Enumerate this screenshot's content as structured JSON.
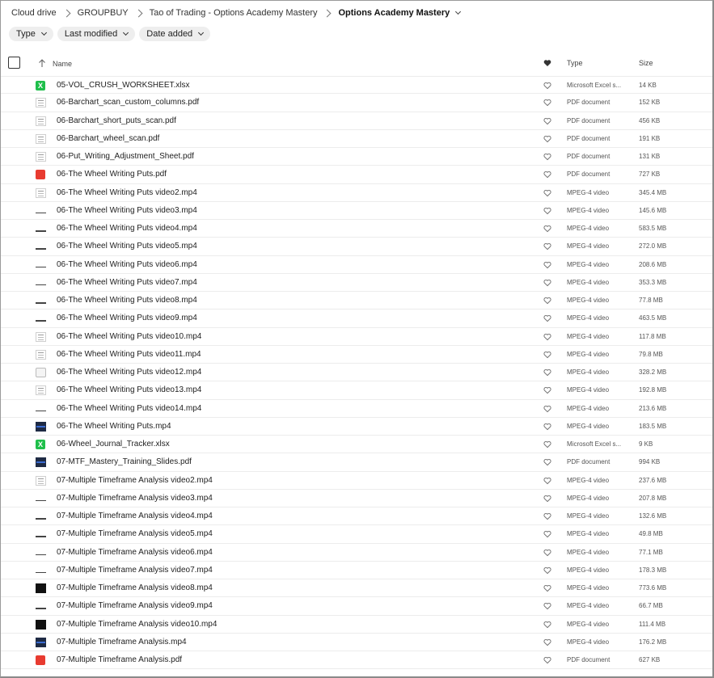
{
  "breadcrumb": {
    "items": [
      "Cloud drive",
      "GROUPBUY",
      "Tao of Trading - Options Academy Mastery"
    ],
    "current": "Options Academy Mastery"
  },
  "filters": {
    "type": "Type",
    "last_modified": "Last modified",
    "date_added": "Date added"
  },
  "columns": {
    "name": "Name",
    "type": "Type",
    "size": "Size"
  },
  "files": [
    {
      "name": "05-VOL_CRUSH_WORKSHEET.xlsx",
      "type": "Microsoft Excel s...",
      "size": "14 KB",
      "icon": "xlsx-icon"
    },
    {
      "name": "06-Barchart_scan_custom_columns.pdf",
      "type": "PDF document",
      "size": "152 KB",
      "icon": "document-thumbnail-icon"
    },
    {
      "name": "06-Barchart_short_puts_scan.pdf",
      "type": "PDF document",
      "size": "456 KB",
      "icon": "document-thumbnail-icon"
    },
    {
      "name": "06-Barchart_wheel_scan.pdf",
      "type": "PDF document",
      "size": "191 KB",
      "icon": "document-thumbnail-icon"
    },
    {
      "name": "06-Put_Writing_Adjustment_Sheet.pdf",
      "type": "PDF document",
      "size": "131 KB",
      "icon": "document-thumbnail-icon"
    },
    {
      "name": "06-The Wheel Writing Puts.pdf",
      "type": "PDF document",
      "size": "727 KB",
      "icon": "pdf-icon"
    },
    {
      "name": "06-The Wheel Writing Puts video2.mp4",
      "type": "MPEG-4 video",
      "size": "345.4 MB",
      "icon": "document-thumbnail-icon"
    },
    {
      "name": "06-The Wheel Writing Puts video3.mp4",
      "type": "MPEG-4 video",
      "size": "145.6 MB",
      "icon": "video-thumbnail-icon"
    },
    {
      "name": "06-The Wheel Writing Puts video4.mp4",
      "type": "MPEG-4 video",
      "size": "583.5 MB",
      "icon": "video-thumbnail-icon"
    },
    {
      "name": "06-The Wheel Writing Puts video5.mp4",
      "type": "MPEG-4 video",
      "size": "272.0 MB",
      "icon": "video-thumbnail-icon"
    },
    {
      "name": "06-The Wheel Writing Puts video6.mp4",
      "type": "MPEG-4 video",
      "size": "208.6 MB",
      "icon": "video-thumbnail-icon"
    },
    {
      "name": "06-The Wheel Writing Puts video7.mp4",
      "type": "MPEG-4 video",
      "size": "353.3 MB",
      "icon": "video-thumbnail-icon"
    },
    {
      "name": "06-The Wheel Writing Puts video8.mp4",
      "type": "MPEG-4 video",
      "size": "77.8 MB",
      "icon": "video-thumbnail-icon"
    },
    {
      "name": "06-The Wheel Writing Puts video9.mp4",
      "type": "MPEG-4 video",
      "size": "463.5 MB",
      "icon": "video-thumbnail-icon"
    },
    {
      "name": "06-The Wheel Writing Puts video10.mp4",
      "type": "MPEG-4 video",
      "size": "117.8 MB",
      "icon": "document-thumbnail-icon"
    },
    {
      "name": "06-The Wheel Writing Puts video11.mp4",
      "type": "MPEG-4 video",
      "size": "79.8 MB",
      "icon": "document-thumbnail-icon"
    },
    {
      "name": "06-The Wheel Writing Puts video12.mp4",
      "type": "MPEG-4 video",
      "size": "328.2 MB",
      "icon": "gear-thumbnail-icon"
    },
    {
      "name": "06-The Wheel Writing Puts video13.mp4",
      "type": "MPEG-4 video",
      "size": "192.8 MB",
      "icon": "document-thumbnail-icon"
    },
    {
      "name": "06-The Wheel Writing Puts video14.mp4",
      "type": "MPEG-4 video",
      "size": "213.6 MB",
      "icon": "video-thumbnail-icon"
    },
    {
      "name": "06-The Wheel Writing Puts.mp4",
      "type": "MPEG-4 video",
      "size": "183.5 MB",
      "icon": "dark-thumbnail-icon"
    },
    {
      "name": "06-Wheel_Journal_Tracker.xlsx",
      "type": "Microsoft Excel s...",
      "size": "9 KB",
      "icon": "xlsx-icon"
    },
    {
      "name": "07-MTF_Mastery_Training_Slides.pdf",
      "type": "PDF document",
      "size": "994 KB",
      "icon": "dark-thumbnail-icon"
    },
    {
      "name": "07-Multiple Timeframe Analysis video2.mp4",
      "type": "MPEG-4 video",
      "size": "237.6 MB",
      "icon": "document-thumbnail-icon"
    },
    {
      "name": "07-Multiple Timeframe Analysis video3.mp4",
      "type": "MPEG-4 video",
      "size": "207.8 MB",
      "icon": "video-thumbnail-icon"
    },
    {
      "name": "07-Multiple Timeframe Analysis video4.mp4",
      "type": "MPEG-4 video",
      "size": "132.6 MB",
      "icon": "video-thumbnail-icon"
    },
    {
      "name": "07-Multiple Timeframe Analysis video5.mp4",
      "type": "MPEG-4 video",
      "size": "49.8 MB",
      "icon": "video-thumbnail-icon"
    },
    {
      "name": "07-Multiple Timeframe Analysis video6.mp4",
      "type": "MPEG-4 video",
      "size": "77.1 MB",
      "icon": "video-thumbnail-icon"
    },
    {
      "name": "07-Multiple Timeframe Analysis video7.mp4",
      "type": "MPEG-4 video",
      "size": "178.3 MB",
      "icon": "video-thumbnail-icon"
    },
    {
      "name": "07-Multiple Timeframe Analysis video8.mp4",
      "type": "MPEG-4 video",
      "size": "773.6 MB",
      "icon": "black-thumbnail-icon"
    },
    {
      "name": "07-Multiple Timeframe Analysis video9.mp4",
      "type": "MPEG-4 video",
      "size": "66.7 MB",
      "icon": "video-thumbnail-icon"
    },
    {
      "name": "07-Multiple Timeframe Analysis video10.mp4",
      "type": "MPEG-4 video",
      "size": "111.4 MB",
      "icon": "black-thumbnail-icon"
    },
    {
      "name": "07-Multiple Timeframe Analysis.mp4",
      "type": "MPEG-4 video",
      "size": "176.2 MB",
      "icon": "dark-thumbnail-icon"
    },
    {
      "name": "07-Multiple Timeframe Analysis.pdf",
      "type": "PDF document",
      "size": "627 KB",
      "icon": "pdf-icon"
    }
  ],
  "icons": {
    "sort": "arrow-up-icon",
    "favorite_header": "heart-filled-icon",
    "favorite_row": "heart-outline-icon",
    "dropdown": "chevron-down-icon",
    "breadcrumb_separator": "chevron-right-icon"
  },
  "colors": {
    "xlsx": "#1fbf4b",
    "pdf": "#e83b30",
    "chip_bg": "#eeeeee",
    "row_divider": "#ececec"
  }
}
